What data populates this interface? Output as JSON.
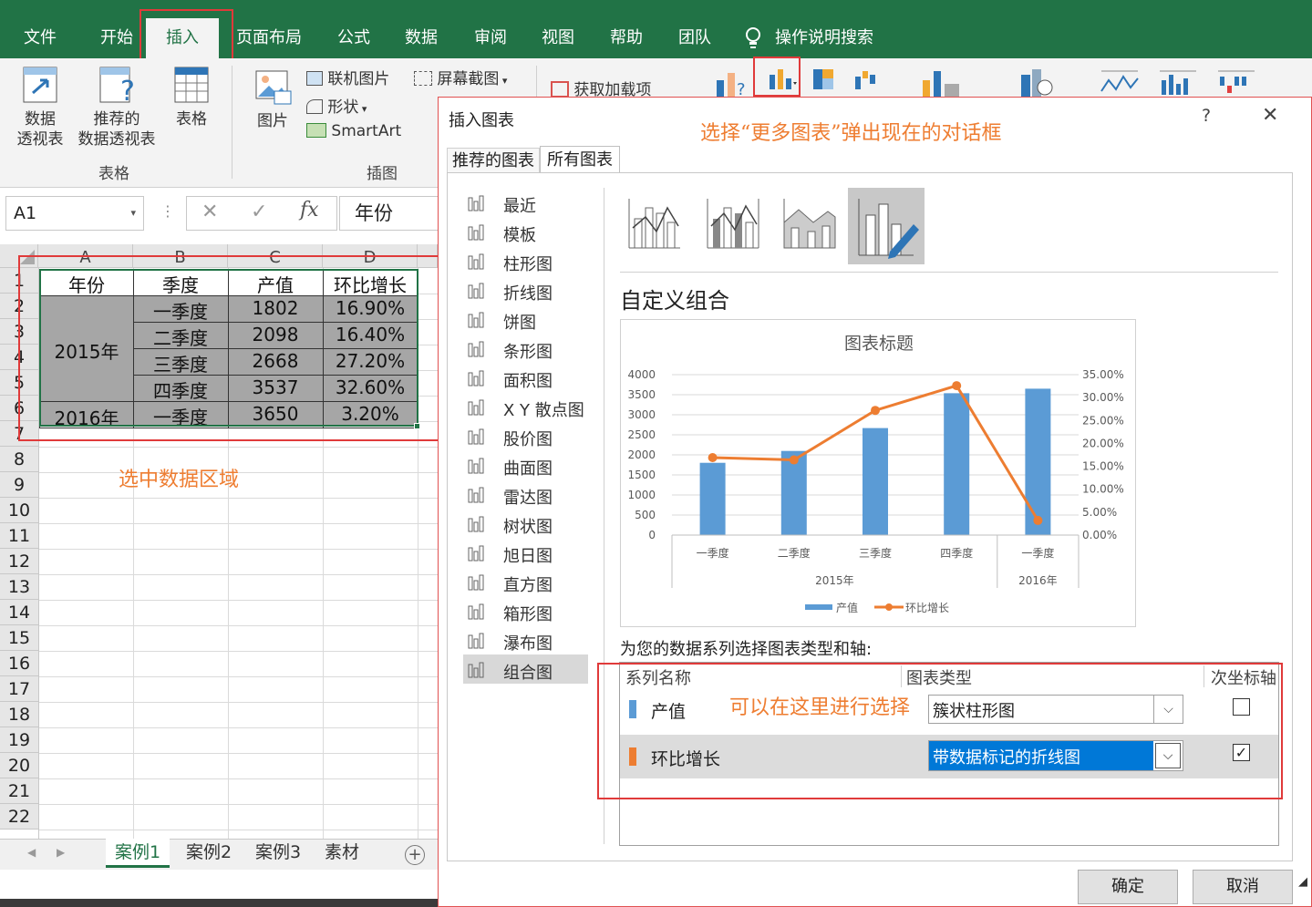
{
  "menu": [
    "文件",
    "开始",
    "插入",
    "页面布局",
    "公式",
    "数据",
    "审阅",
    "视图",
    "帮助",
    "团队",
    "操作说明搜索"
  ],
  "ribbon": {
    "pivot_l1": "数据",
    "pivot_l2": "透视表",
    "rec_pivot_l1": "推荐的",
    "rec_pivot_l2": "数据透视表",
    "table": "表格",
    "group_tables": "表格",
    "picture": "图片",
    "online_pictures": "联机图片",
    "shapes": "形状",
    "smartart": "SmartArt",
    "screenshot": "屏幕截图",
    "group_illustrations": "插图",
    "get_addins": "获取加载项"
  },
  "formula_bar": {
    "name_box": "A1",
    "value": "年份"
  },
  "sheet": {
    "col_headers": [
      "A",
      "B",
      "C",
      "D"
    ],
    "row_headers": [
      "1",
      "2",
      "3",
      "4",
      "5",
      "6",
      "7",
      "8",
      "9",
      "10",
      "11",
      "12",
      "13",
      "14",
      "15",
      "16",
      "17",
      "18",
      "19",
      "20",
      "21",
      "22"
    ],
    "headers": [
      "年份",
      "季度",
      "产值",
      "环比增长"
    ],
    "year_2015": "2015年",
    "year_2016": "2016年",
    "rows": [
      {
        "quarter": "一季度",
        "value": "1802",
        "growth": "16.90%"
      },
      {
        "quarter": "二季度",
        "value": "2098",
        "growth": "16.40%"
      },
      {
        "quarter": "三季度",
        "value": "2668",
        "growth": "27.20%"
      },
      {
        "quarter": "四季度",
        "value": "3537",
        "growth": "32.60%"
      },
      {
        "quarter": "一季度",
        "value": "3650",
        "growth": "3.20%"
      }
    ]
  },
  "sheet_tabs": [
    "案例1",
    "案例2",
    "案例3",
    "素材"
  ],
  "annotations": {
    "select_data": "选中数据区域",
    "dialog_note": "选择“更多图表”弹出现在的对话框",
    "choose_here": "可以在这里进行选择"
  },
  "dialog": {
    "title": "插入图表",
    "help": "?",
    "close": "✕",
    "tabs": [
      "推荐的图表",
      "所有图表"
    ],
    "categories": [
      "最近",
      "模板",
      "柱形图",
      "折线图",
      "饼图",
      "条形图",
      "面积图",
      "X Y 散点图",
      "股价图",
      "曲面图",
      "雷达图",
      "树状图",
      "旭日图",
      "直方图",
      "箱形图",
      "瀑布图",
      "组合图"
    ],
    "section_title": "自定义组合",
    "series_prompt": "为您的数据系列选择图表类型和轴:",
    "col_series": "系列名称",
    "col_type": "图表类型",
    "col_secondary": "次坐标轴",
    "series": [
      {
        "name": "产值",
        "type": "簇状柱形图",
        "secondary": false,
        "color": "#5b9bd5"
      },
      {
        "name": "环比增长",
        "type": "带数据标记的折线图",
        "secondary": true,
        "color": "#ed7d31"
      }
    ],
    "ok": "确定",
    "cancel": "取消"
  },
  "chart_data": {
    "type": "bar",
    "title": "图表标题",
    "categories": [
      "一季度",
      "二季度",
      "三季度",
      "四季度",
      "一季度"
    ],
    "groups": [
      {
        "label": "2015年",
        "span": 4
      },
      {
        "label": "2016年",
        "span": 1
      }
    ],
    "y_ticks": [
      "4000",
      "3500",
      "3000",
      "2500",
      "2000",
      "1500",
      "1000",
      "500",
      "0"
    ],
    "y2_ticks": [
      "35.00%",
      "30.00%",
      "25.00%",
      "20.00%",
      "15.00%",
      "10.00%",
      "5.00%",
      "0.00%"
    ],
    "ylim": [
      0,
      4000
    ],
    "y2lim": [
      0,
      0.35
    ],
    "series": [
      {
        "name": "产值",
        "type": "bar",
        "axis": "primary",
        "values": [
          1802,
          2098,
          2668,
          3537,
          3650
        ],
        "color": "#5b9bd5"
      },
      {
        "name": "环比增长",
        "type": "line",
        "axis": "secondary",
        "values": [
          0.169,
          0.164,
          0.272,
          0.326,
          0.032
        ],
        "color": "#ed7d31"
      }
    ],
    "legend": "bottom",
    "grid": true
  }
}
